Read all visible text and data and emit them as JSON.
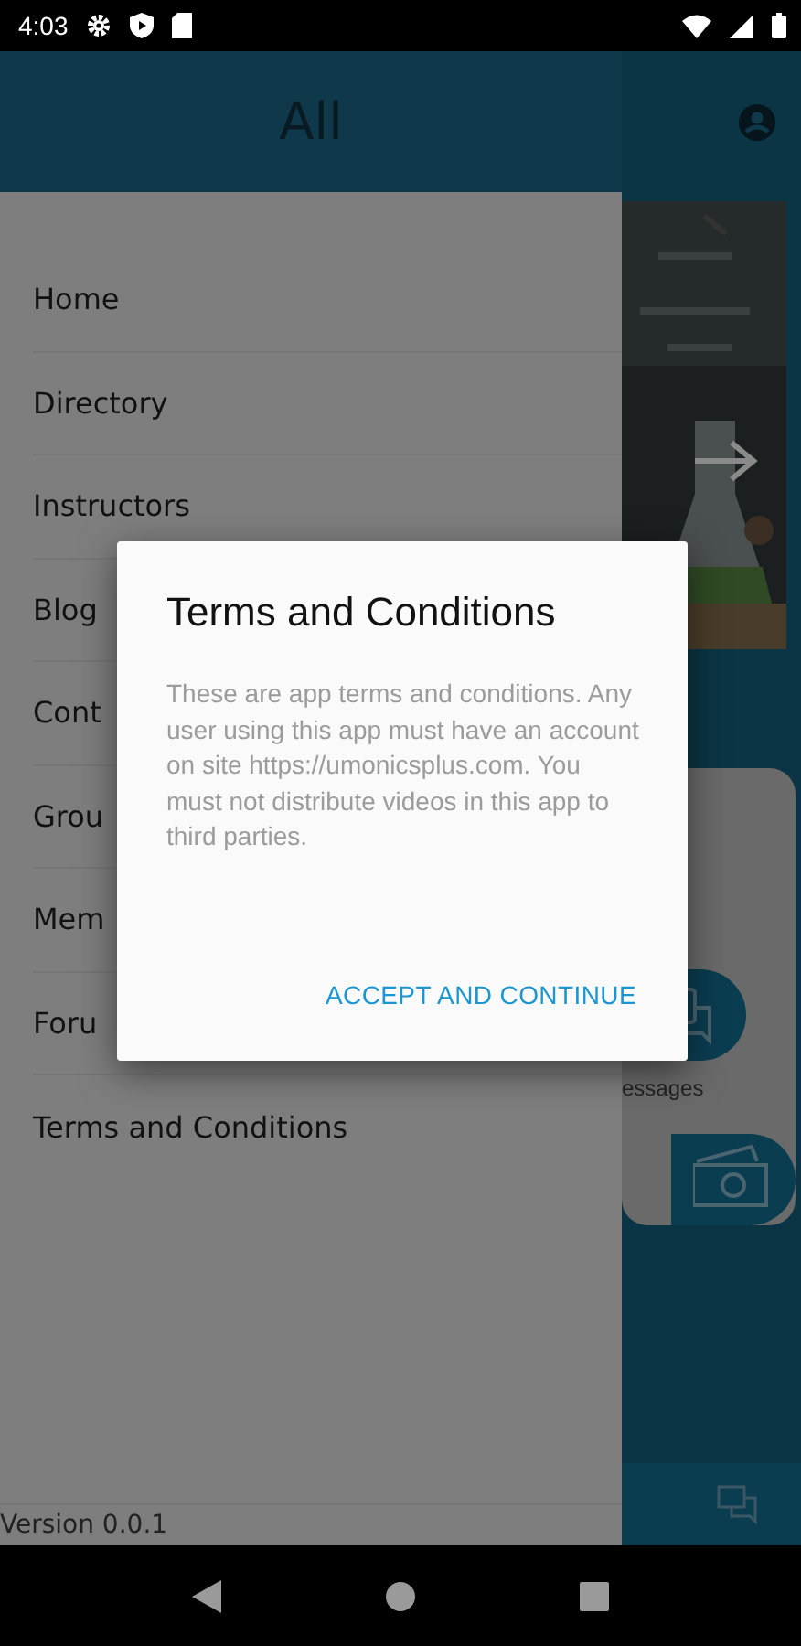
{
  "status_bar": {
    "time": "4:03"
  },
  "drawer": {
    "title": "All",
    "items": [
      {
        "label": "Home"
      },
      {
        "label": "Directory"
      },
      {
        "label": "Instructors"
      },
      {
        "label": "Blog"
      },
      {
        "label": "Cont"
      },
      {
        "label": "Grou"
      },
      {
        "label": "Mem"
      },
      {
        "label": "Foru"
      },
      {
        "label": "Terms and Conditions"
      }
    ],
    "version": "Version 0.0.1"
  },
  "background": {
    "tile_label": "essages"
  },
  "dialog": {
    "title": "Terms and Conditions",
    "body": "These are app terms and conditions. Any user using this app must have an account on site https://umonicsplus.com. You must not distribute videos in this app to third parties.",
    "action": "ACCEPT AND CONTINUE"
  }
}
